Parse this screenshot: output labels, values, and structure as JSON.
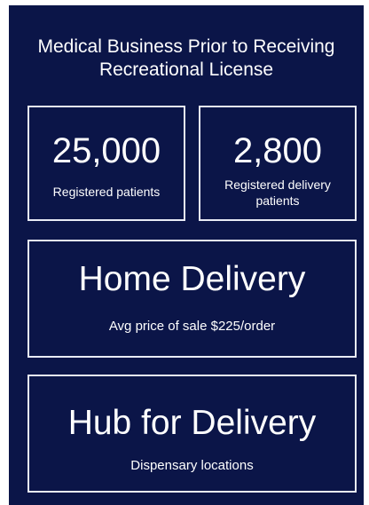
{
  "title": "Medical Business Prior to Receiving Recreational License",
  "stats": [
    {
      "value": "25,000",
      "label": "Registered patients"
    },
    {
      "value": "2,800",
      "label": "Registered delivery patients"
    }
  ],
  "home_delivery": {
    "title": "Home Delivery",
    "subtitle": "Avg price of sale $225/order"
  },
  "hub": {
    "title": "Hub for Delivery",
    "subtitle": "Dispensary locations"
  },
  "colors": {
    "background": "#0b1548",
    "text": "#ffffff",
    "border": "#e8ebf5"
  }
}
